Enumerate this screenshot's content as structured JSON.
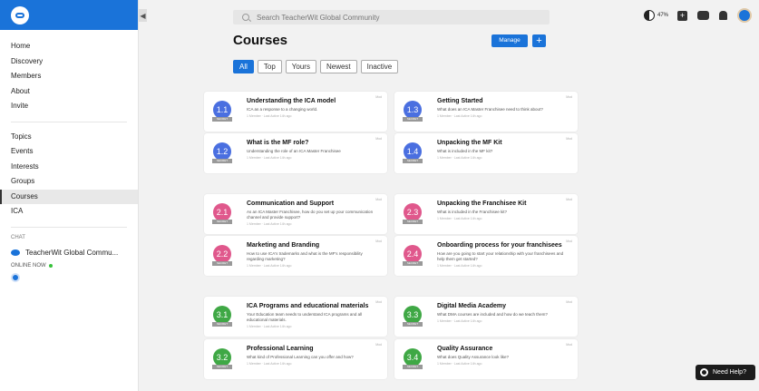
{
  "search": {
    "placeholder": "Search TeacherWit Global Community"
  },
  "topbar": {
    "contrast_pct": "47%"
  },
  "sidebar": {
    "nav": [
      "Home",
      "Discovery",
      "Members",
      "About",
      "Invite"
    ],
    "nav2": [
      "Topics",
      "Events",
      "Interests",
      "Groups",
      "Courses",
      "ICA"
    ],
    "active": "Courses",
    "chat_heading": "CHAT",
    "chat_item": "TeacherWit Global Commu...",
    "online_label": "ONLINE NOW"
  },
  "header": {
    "title": "Courses",
    "manage_label": "Manage",
    "add_label": "+"
  },
  "filters": [
    "All",
    "Top",
    "Yours",
    "Newest",
    "Inactive"
  ],
  "secret_label": "SECRET",
  "pin_label": "Mod",
  "help_label": "Need Help?",
  "courses": [
    {
      "num": "1.1",
      "title": "Understanding the ICA model",
      "desc": "ICA as a response to a changing world.",
      "meta": "1 Member · Last Active 14h ago",
      "color": "#4a6fe0"
    },
    {
      "num": "1.3",
      "title": "Getting Started",
      "desc": "What does an ICA Master Franchisee need to think about?",
      "meta": "1 Member · Last Active 14h ago",
      "color": "#4a6fe0"
    },
    {
      "num": "1.2",
      "title": "What is the MF role?",
      "desc": "Understanding the role of an ICA Master Franchisee",
      "meta": "1 Member · Last Active 14h ago",
      "color": "#4a6fe0"
    },
    {
      "num": "1.4",
      "title": "Unpacking the MF Kit",
      "desc": "What is included in the MF kit?",
      "meta": "1 Member · Last Active 14h ago",
      "color": "#4a6fe0"
    },
    {
      "num": "2.1",
      "title": "Communication and Support",
      "desc": "As an ICA Master Franchisee, how do you set up your communication channel and provide support?",
      "meta": "1 Member · Last Active 14h ago",
      "color": "#e0588c"
    },
    {
      "num": "2.3",
      "title": "Unpacking the Franchisee Kit",
      "desc": "What is included in the Franchisee kit?",
      "meta": "1 Member · Last Active 14h ago",
      "color": "#e0588c"
    },
    {
      "num": "2.2",
      "title": "Marketing and Branding",
      "desc": "How to use ICA's trademarks and what is the MF's responsibility regarding marketing?",
      "meta": "1 Member · Last Active 14h ago",
      "color": "#e0588c"
    },
    {
      "num": "2.4",
      "title": "Onboarding process for your franchisees",
      "desc": "How are you going to start your relationship with your franchisees and help them get started?",
      "meta": "1 Member · Last Active 14h ago",
      "color": "#e0588c"
    },
    {
      "num": "3.1",
      "title": "ICA Programs and educational materials",
      "desc": "Your Education team needs to understand ICA programs and all educational materials.",
      "meta": "1 Member · Last Active 14h ago",
      "color": "#3fa845"
    },
    {
      "num": "3.3",
      "title": "Digital Media Academy",
      "desc": "What DMA courses are included and how do we teach them?",
      "meta": "1 Member · Last Active 14h ago",
      "color": "#3fa845"
    },
    {
      "num": "3.2",
      "title": "Professional Learning",
      "desc": "What kind of Professional Learning can you offer and how?",
      "meta": "1 Member · Last Active 14h ago",
      "color": "#3fa845"
    },
    {
      "num": "3.4",
      "title": "Quality Assurance",
      "desc": "What does Quality Assurance look like?",
      "meta": "1 Member · Last Active 14h ago",
      "color": "#3fa845"
    }
  ]
}
